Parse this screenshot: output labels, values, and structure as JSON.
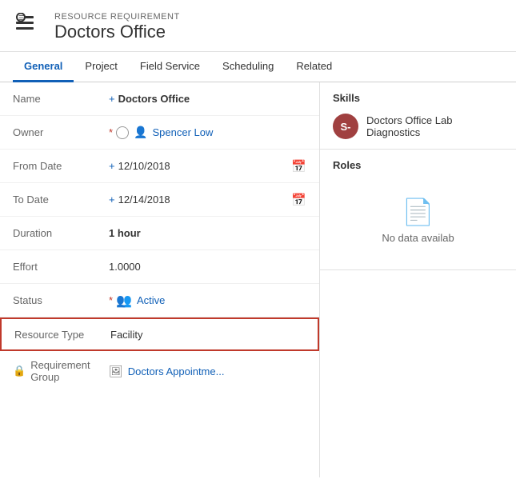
{
  "header": {
    "subtitle": "RESOURCE REQUIREMENT",
    "title": "Doctors Office"
  },
  "tabs": [
    {
      "id": "general",
      "label": "General",
      "active": true
    },
    {
      "id": "project",
      "label": "Project",
      "active": false
    },
    {
      "id": "field-service",
      "label": "Field Service",
      "active": false
    },
    {
      "id": "scheduling",
      "label": "Scheduling",
      "active": false
    },
    {
      "id": "related",
      "label": "Related",
      "active": false
    }
  ],
  "form": {
    "name_label": "Name",
    "name_value": "Doctors Office",
    "owner_label": "Owner",
    "owner_value": "Spencer Low",
    "from_date_label": "From Date",
    "from_date_value": "12/10/2018",
    "to_date_label": "To Date",
    "to_date_value": "12/14/2018",
    "duration_label": "Duration",
    "duration_value": "1 hour",
    "effort_label": "Effort",
    "effort_value": "1.0000",
    "status_label": "Status",
    "status_value": "Active",
    "resource_type_label": "Resource Type",
    "resource_type_value": "Facility",
    "req_group_label": "Requirement Group",
    "req_group_value": "Doctors Appointme..."
  },
  "skills": {
    "section_title": "Skills",
    "item_avatar_text": "S-",
    "item_name": "Doctors Office Lab Diagnostics"
  },
  "roles": {
    "section_title": "Roles",
    "no_data_text": "No data availab"
  }
}
